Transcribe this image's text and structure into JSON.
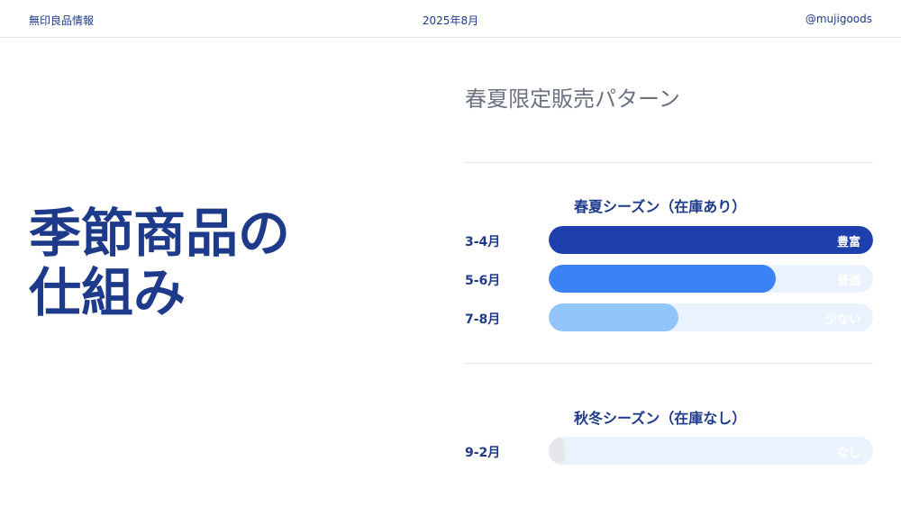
{
  "header": {
    "brand": "無印良品情報",
    "date": "2025年8月",
    "handle": "@mujigoods"
  },
  "hero": {
    "line1": "季節商品の",
    "line2": "仕組み"
  },
  "panel": {
    "title": "春夏限定販売パターン"
  },
  "colors": {
    "dark_blue": "#1e40af",
    "medium_blue": "#3b82f6",
    "light_blue": "#93c5fd",
    "track": "#eaf2fe",
    "empty_cap": "#e5e7eb"
  },
  "chart_data": {
    "type": "bar",
    "orientation": "horizontal",
    "groups": [
      {
        "title": "春夏シーズン（在庫あり）",
        "rows": [
          {
            "period": "3-4月",
            "value": 1.0,
            "label": "豊富"
          },
          {
            "period": "5-6月",
            "value": 0.7,
            "label": "普通"
          },
          {
            "period": "7-8月",
            "value": 0.4,
            "label": "少ない"
          }
        ]
      },
      {
        "title": "秋冬シーズン（在庫なし）",
        "rows": [
          {
            "period": "9-2月",
            "value": 0.05,
            "label": "なし"
          }
        ]
      }
    ],
    "xlim": [
      0,
      1
    ]
  }
}
